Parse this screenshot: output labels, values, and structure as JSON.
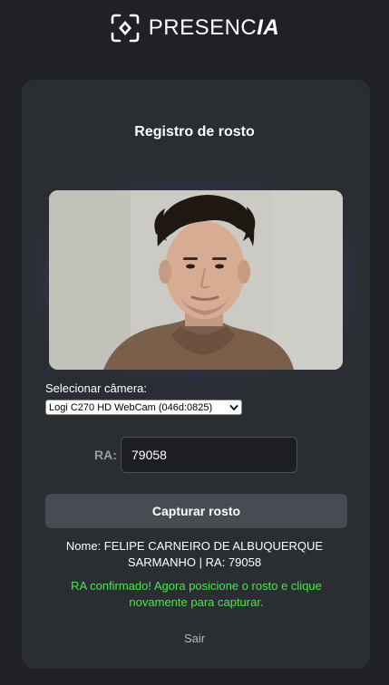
{
  "brand": {
    "logo_prefix": "PRESENC",
    "logo_suffix": "IA",
    "logo_icon": "scan-face-icon"
  },
  "card": {
    "title": "Registro de rosto"
  },
  "camera": {
    "feed_icon": "webcam-feed",
    "label": "Selecionar câmera:",
    "selected_option": "Logi C270 HD WebCam (046d:0825)"
  },
  "form": {
    "ra_label": "RA:",
    "ra_value": "79058"
  },
  "actions": {
    "capture_label": "Capturar rosto",
    "logout_label": "Sair"
  },
  "student": {
    "info_line": "Nome: FELIPE CARNEIRO DE ALBUQUERQUE SARMANHO | RA: 79058"
  },
  "status": {
    "message": "RA confirmado! Agora posicione o rosto e clique novamente para capturar.",
    "color": "#4ee44e"
  },
  "colors": {
    "background": "#1f2125",
    "card": "#2a2d32",
    "button": "#484b52"
  }
}
